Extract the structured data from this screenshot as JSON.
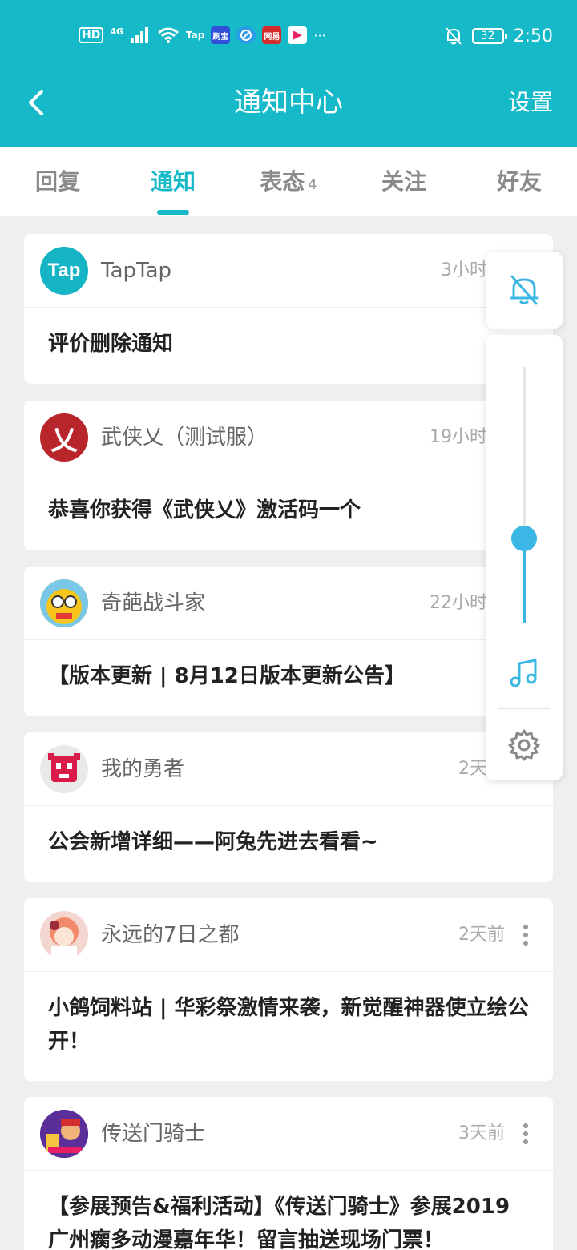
{
  "status_bar": {
    "network_hd": "HD",
    "network_type": "4G",
    "app_taptap": "Tap",
    "app_shuabao": "刷宝",
    "app_netease": "网易",
    "app_more": "···",
    "battery": "32",
    "time": "2:50",
    "icons": [
      "signal-icon",
      "wifi-icon",
      "browser-icon",
      "youku-icon",
      "bell-off-icon"
    ]
  },
  "app_bar": {
    "title": "通知中心",
    "settings": "设置"
  },
  "tabs": [
    {
      "label": "回复"
    },
    {
      "label": "通知",
      "active": true
    },
    {
      "label": "表态",
      "badge": "4"
    },
    {
      "label": "关注"
    },
    {
      "label": "好友"
    }
  ],
  "notifications": [
    {
      "source": "TapTap",
      "time": "3小时前",
      "text": "评价删除通知",
      "avatar_text": "Tap"
    },
    {
      "source": "武侠乂（测试服）",
      "time": "19小时前",
      "text": "恭喜你获得《武侠乂》激活码一个",
      "avatar_text": "乂"
    },
    {
      "source": "奇葩战斗家",
      "time": "22小时前",
      "text": "【版本更新 | 8月12日版本更新公告】"
    },
    {
      "source": "我的勇者",
      "time": "2天前",
      "text": "公会新增详细——阿兔先进去看看~"
    },
    {
      "source": "永远的7日之都",
      "time": "2天前",
      "text": "小鸽饲料站 | 华彩祭激情来袭，新觉醒神器使立绘公开！"
    },
    {
      "source": "传送门骑士",
      "time": "3天前",
      "text": "【参展预告&福利活动】《传送门骑士》参展2019广州瘸多动漫嘉年华！留言抽送现场门票！"
    }
  ],
  "volume_panel": {
    "level": 0.33,
    "accent": "#3ab7e4"
  },
  "colors": {
    "brand": "#16b9c8",
    "background": "#efefef"
  }
}
